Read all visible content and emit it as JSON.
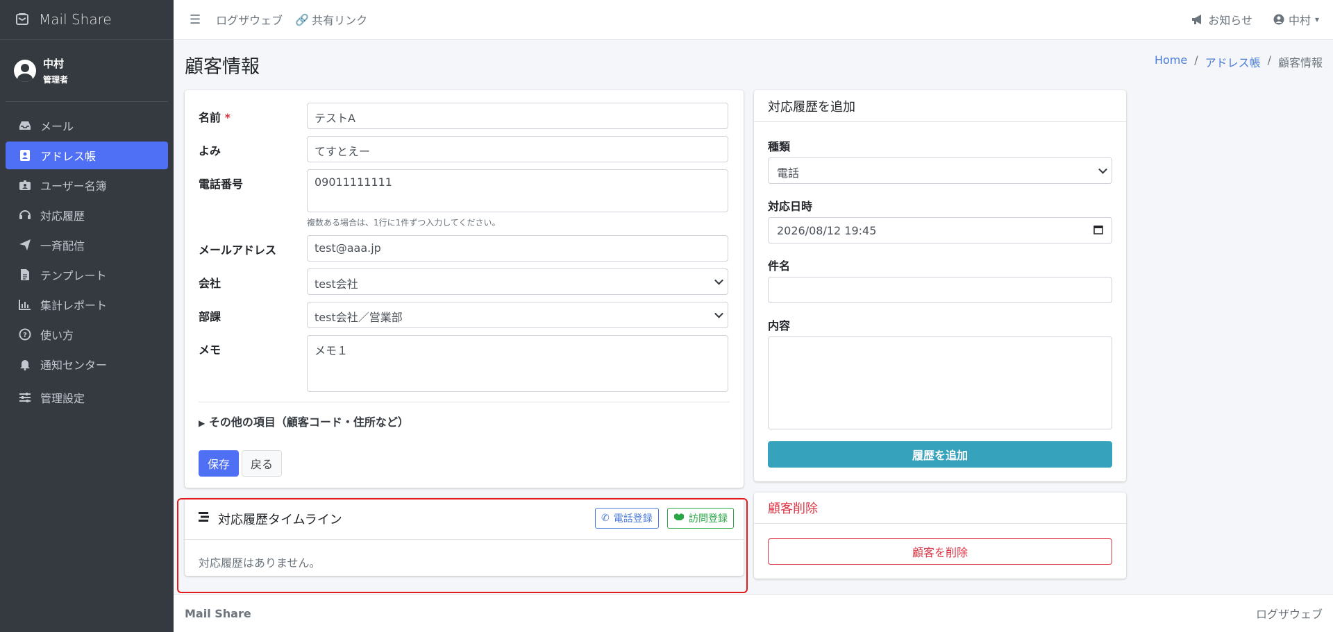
{
  "brand": {
    "name": "Mail Share"
  },
  "user": {
    "name": "中村",
    "role": "管理者"
  },
  "sidebar": {
    "items": [
      {
        "label": "メール",
        "icon": "inbox-icon"
      },
      {
        "label": "アドレス帳",
        "icon": "address-book-icon",
        "active": true
      },
      {
        "label": "ユーザー名簿",
        "icon": "id-badge-icon"
      },
      {
        "label": "対応履歴",
        "icon": "headset-icon"
      },
      {
        "label": "一斉配信",
        "icon": "paper-plane-icon"
      },
      {
        "label": "テンプレート",
        "icon": "file-icon"
      },
      {
        "label": "集計レポート",
        "icon": "bar-chart-icon"
      },
      {
        "label": "使い方",
        "icon": "question-circle-icon"
      },
      {
        "label": "通知センター",
        "icon": "bell-icon"
      },
      {
        "label": "管理設定",
        "icon": "sliders-icon"
      }
    ]
  },
  "topbar": {
    "link1": "ログザウェブ",
    "link2": "共有リンク",
    "notice": "お知らせ",
    "user": "中村"
  },
  "page": {
    "title": "顧客情報"
  },
  "breadcrumb": {
    "home": "Home",
    "addressbook": "アドレス帳",
    "current": "顧客情報",
    "sep": "/"
  },
  "form": {
    "name_label": "名前",
    "required_mark": "*",
    "name_value": "テストA",
    "yomi_label": "よみ",
    "yomi_value": "てすとえー",
    "phone_label": "電話番号",
    "phone_value": "09011111111",
    "phone_hint": "複数ある場合は、1行に1件ずつ入力してください。",
    "email_label": "メールアドレス",
    "email_value": "test@aaa.jp",
    "company_label": "会社",
    "company_value": "test会社",
    "dept_label": "部課",
    "dept_value": "test会社／営業部",
    "memo_label": "メモ",
    "memo_value": "メモ１",
    "details_summary": "その他の項目（顧客コード・住所など）",
    "save_label": "保存",
    "back_label": "戻る"
  },
  "timeline": {
    "title": "対応履歴タイムライン",
    "phone_btn": "電話登録",
    "visit_btn": "訪問登録",
    "empty": "対応履歴はありません。"
  },
  "history_add": {
    "title": "対応履歴を追加",
    "type_label": "種類",
    "type_value": "電話",
    "datetime_label": "対応日時",
    "datetime_value": "2026/08/12 19:45",
    "subject_label": "件名",
    "subject_value": "",
    "content_label": "内容",
    "content_value": "",
    "submit_label": "履歴を追加"
  },
  "delete": {
    "title": "顧客削除",
    "button": "顧客を削除"
  },
  "footer": {
    "left": "Mail Share",
    "right": "ログザウェブ"
  },
  "colors": {
    "primary": "#4f6ff5",
    "info": "#36a2bb",
    "danger": "#dc3545",
    "success": "#28a745",
    "sidebar": "#343a40",
    "highlight": "#e31b1b"
  }
}
